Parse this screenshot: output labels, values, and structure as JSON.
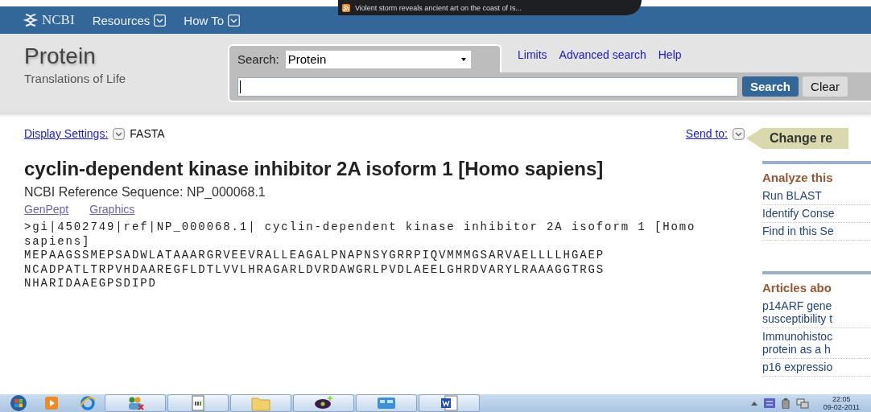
{
  "header": {
    "logo": "NCBI",
    "menus": [
      {
        "label": "Resources"
      },
      {
        "label": "How To"
      }
    ],
    "news": "Violent storm reveals ancient art on the coast of Is..."
  },
  "database": {
    "title": "Protein",
    "tagline": "Translations of Life"
  },
  "search": {
    "label": "Search:",
    "database": "Protein",
    "links": [
      "Limits",
      "Advanced search",
      "Help"
    ],
    "buttons": [
      {
        "label": "Search",
        "kind": "primary"
      },
      {
        "label": "Clear",
        "kind": "secondary"
      }
    ]
  },
  "display": {
    "settings_link": "Display Settings:",
    "format": "FASTA",
    "send_to": "Send to:"
  },
  "record": {
    "title": "cyclin-dependent kinase inhibitor 2A isoform 1 [Homo sapiens]",
    "reference": "NCBI Reference Sequence: NP_000068.1",
    "views": [
      "GenPept",
      "Graphics"
    ],
    "fasta": [
      ">gi|4502749|ref|NP_000068.1| cyclin-dependent kinase inhibitor 2A isoform 1 [Homo",
      "sapiens]",
      "MEPAAGSSMEPSADWLATAAARGRVEEVRALLEAGALPNAPNSYGRRPIQVMMMGSARVAELLLLHGAEP",
      "NCADPATLTRPVHDAAREGFLDTLVVLHRAGARLDVRDAWGRLPVDLAEELGHRDVARYLRAAAGGTRGS",
      "NHARIDAAEGPSDIPD"
    ]
  },
  "sidebar": {
    "change": "Change re",
    "sections": [
      {
        "title": "Analyze this",
        "items": [
          {
            "lines": [
              "Run BLAST"
            ]
          },
          {
            "lines": [
              "Identify Conse"
            ]
          },
          {
            "lines": [
              "Find in this Se"
            ]
          }
        ]
      },
      {
        "title": "Articles abo",
        "items": [
          {
            "lines": [
              "p14ARF gene",
              "susceptibility t"
            ]
          },
          {
            "lines": [
              "Immunohistoc",
              "protein as a h"
            ]
          },
          {
            "lines": [
              "p16 expressio"
            ]
          }
        ]
      }
    ]
  },
  "taskbar": {
    "time": "22:05",
    "date": "09-02-2011"
  }
}
